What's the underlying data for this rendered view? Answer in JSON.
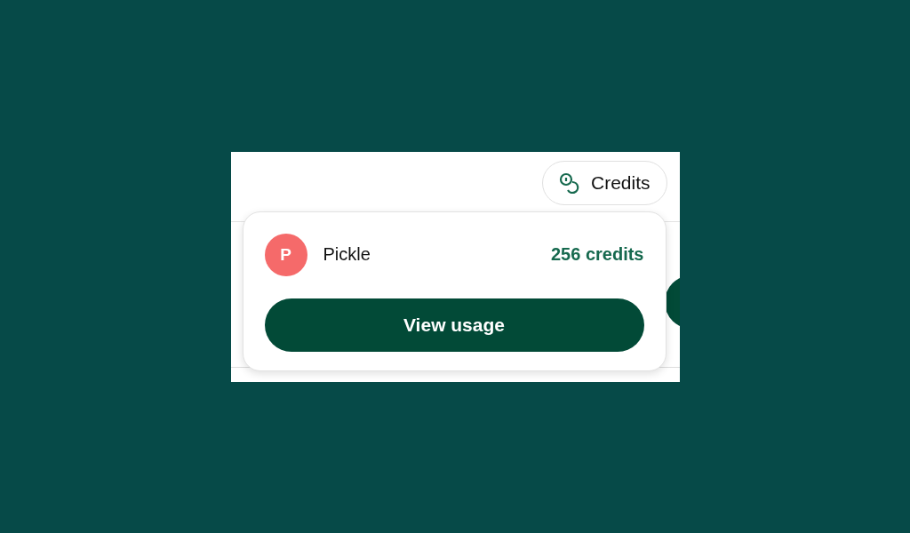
{
  "header": {
    "credits_button": {
      "label": "Credits"
    }
  },
  "credits_popup": {
    "user": {
      "initial": "P",
      "name": "Pickle"
    },
    "balance": "256 credits",
    "action_button": {
      "label": "View usage"
    }
  }
}
